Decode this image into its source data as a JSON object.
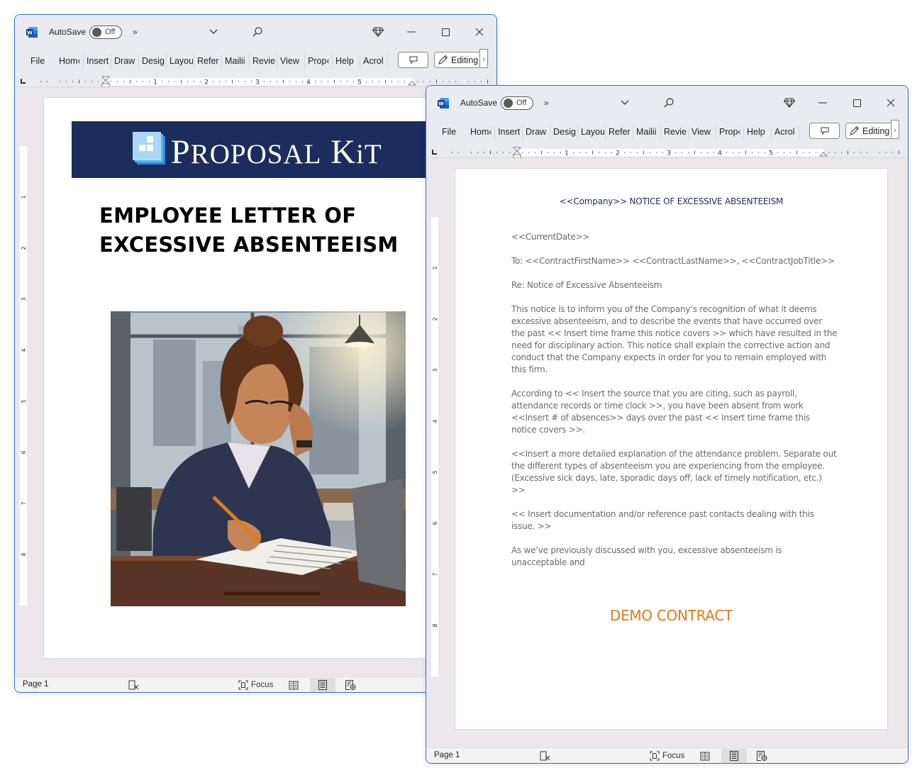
{
  "windows": [
    {
      "id": "cover",
      "titlebar": {
        "app_icon": "word-icon",
        "autosave_label": "AutoSave",
        "autosave_state": "Off",
        "more_label": "»",
        "icons": [
          "chevron-down-icon",
          "search-icon",
          "diamond-premium-icon",
          "minimize-icon",
          "maximize-icon",
          "close-icon"
        ]
      },
      "ribbon": {
        "tabs": [
          "File",
          "Home",
          "Insert",
          "Draw",
          "Design",
          "Layout",
          "References",
          "Mailings",
          "Review",
          "View",
          "Properties",
          "Help",
          "Acrobat"
        ],
        "tabs_visible": [
          "File",
          "Hom‹",
          "Insert",
          "Draw",
          "Desig",
          "Layou",
          "Refer",
          "Mailii",
          "Revie",
          "View",
          "Prop‹",
          "Help",
          "Acrol"
        ],
        "comment_icon": "comment-icon",
        "editing_label": "Editing",
        "editing_icon": "pencil-icon",
        "ribbon_more": "›"
      },
      "ruler": {
        "h_numbers": [
          "1",
          "2",
          "3",
          "4",
          "5"
        ],
        "v_numbers": [
          "1",
          "2",
          "3",
          "4",
          "5",
          "6",
          "7",
          "8"
        ]
      },
      "page": {
        "banner": {
          "brand_first": "P",
          "brand_rest1": "ROPOSAL",
          "brand_second": "K",
          "brand_rest2": "iT",
          "logo_icon": "proposal-kit-logo-icon"
        },
        "title_line1": "EMPLOYEE LETTER OF",
        "title_line2": "EXCESSIVE ABSENTEEISM",
        "illustration": "woman-at-desk-illustration"
      },
      "statusbar": {
        "page_label": "Page 1",
        "accessibility_icon": "accessibility-check-icon",
        "focus_label": "Focus",
        "view_icons": [
          "read-mode-icon",
          "print-layout-icon",
          "web-layout-icon"
        ],
        "active_view": "print-layout"
      }
    },
    {
      "id": "letter",
      "titlebar": {
        "app_icon": "word-icon",
        "autosave_label": "AutoSave",
        "autosave_state": "Off",
        "more_label": "»"
      },
      "ribbon": {
        "tabs_visible": [
          "File",
          "Hom‹",
          "Insert",
          "Draw",
          "Desig",
          "Layou",
          "Refer",
          "Mailii",
          "Revie",
          "View",
          "Prop‹",
          "Help",
          "Acrol"
        ],
        "editing_label": "Editing",
        "ribbon_more": "›"
      },
      "ruler": {
        "h_numbers": [
          "1",
          "2",
          "3",
          "4",
          "5"
        ],
        "v_numbers": [
          "1",
          "2",
          "3",
          "4",
          "5",
          "6",
          "7",
          "8"
        ]
      },
      "page": {
        "heading": "<<Company>> NOTICE OF EXCESSIVE ABSENTEEISM",
        "paragraphs": [
          "<<CurrentDate>>",
          "To: <<ContractFirstName>> <<ContractLastName>>, <<ContractJobTitle>>",
          "Re: Notice of Excessive Absenteeism",
          "This notice is to inform you of the Company’s recognition of what it deems excessive absenteeism, and to describe the events that have occurred over the past << Insert time frame this notice covers >> which have resulted in the need for disciplinary action. This notice shall explain the corrective action and conduct that the Company expects in order for you to remain employed with this firm.",
          "According to << Insert the source that you are citing, such as payroll, attendance records or time clock >>, you have been absent from work <<Insert # of absences>> days over the past << Insert time frame this notice covers >>.",
          "<<Insert a more detailed explanation of the attendance problem. Separate out the different types of absenteeism you are experiencing from the employee. (Excessive sick days, late, sporadic days off, lack of timely notification, etc.) >>",
          "<< Insert documentation and/or reference past contacts dealing with this issue. >>",
          "As we’ve previously discussed with you, excessive absenteeism is unacceptable and"
        ],
        "demo_stamp": "DEMO CONTRACT"
      },
      "statusbar": {
        "page_label": "Page 1",
        "focus_label": "Focus",
        "active_view": "print-layout"
      }
    }
  ],
  "colors": {
    "banner_navy": "#1b2d5c",
    "demo_orange": "#e07a1e",
    "window_border": "#3b6fb6",
    "word_blue": "#2b579a"
  }
}
